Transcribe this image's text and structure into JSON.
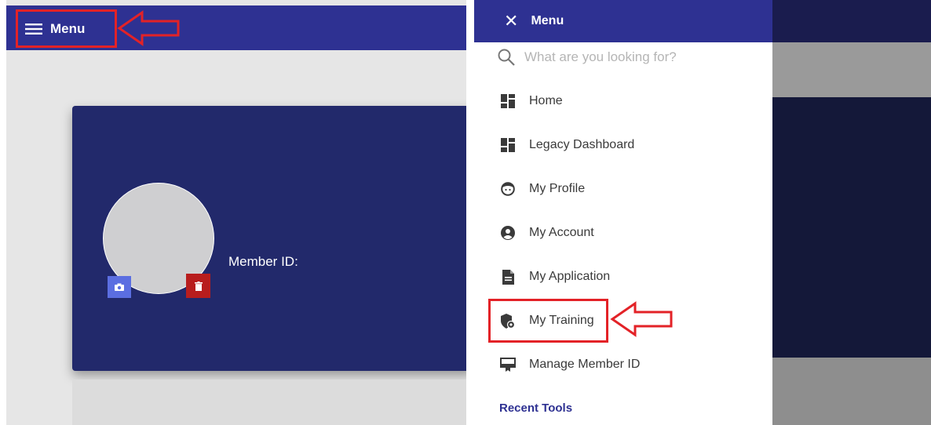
{
  "left": {
    "header": {
      "menu_label": "Menu"
    },
    "profile": {
      "member_id_label": "Member ID:"
    }
  },
  "right": {
    "header": {
      "menu_label": "Menu"
    },
    "search": {
      "placeholder": "What are you looking for?"
    },
    "nav_items": [
      {
        "label": "Home",
        "icon": "dashboard-icon"
      },
      {
        "label": "Legacy Dashboard",
        "icon": "dashboard-icon"
      },
      {
        "label": "My Profile",
        "icon": "face-icon"
      },
      {
        "label": "My Account",
        "icon": "account-circle-icon"
      },
      {
        "label": "My Application",
        "icon": "document-icon"
      },
      {
        "label": "My Training",
        "icon": "shield-icon"
      },
      {
        "label": "Manage Member ID",
        "icon": "id-card-icon"
      }
    ],
    "section_title": "Recent Tools"
  },
  "colors": {
    "brand_blue": "#2e3192",
    "card_navy": "#22296b",
    "callout_red": "#e32227",
    "camera_button": "#5b6ee1",
    "delete_button": "#b81d1d"
  }
}
